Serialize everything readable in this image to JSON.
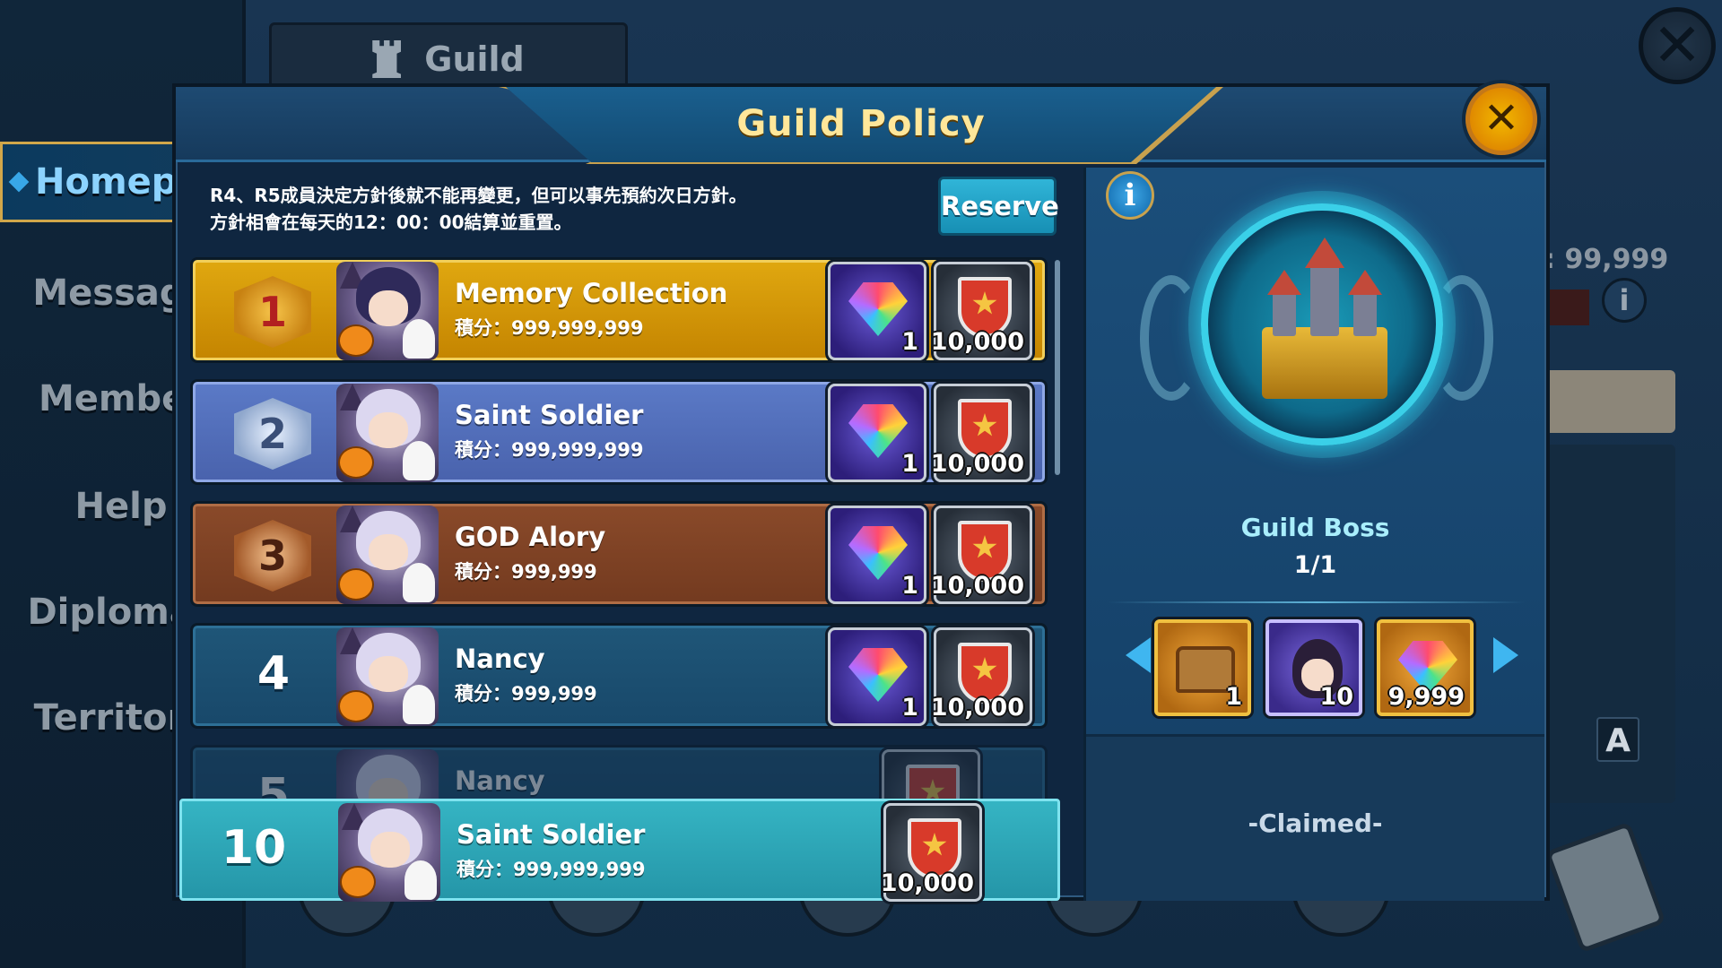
{
  "background": {
    "tab_title": "Guild",
    "sidebar": [
      {
        "label": "Homepag",
        "active": true
      },
      {
        "label": "Message",
        "active": false
      },
      {
        "label": "Member",
        "active": false
      },
      {
        "label": "Help",
        "active": false
      },
      {
        "label": "Diplomac",
        "active": false
      },
      {
        "label": "Territory",
        "active": false
      }
    ],
    "right_value": ": 99,999",
    "translate_icon_letter": "A",
    "close_glyph": "✕",
    "info_glyph": "i"
  },
  "modal": {
    "title": "Guild Policy",
    "close_glyph": "✕",
    "notice_line1": "R4、R5成員決定方針後就不能再變更，但可以事先預約次日方針。",
    "notice_line2": "方針相會在每天的12：00：00結算並重置。",
    "reserve_label": "Reserve"
  },
  "rankings": [
    {
      "rank": "1",
      "style": "gold",
      "name": "Memory Collection",
      "score": "積分：999,999,999",
      "gem_qty": "1",
      "shield_qty": "10,000",
      "avatar": "dark"
    },
    {
      "rank": "2",
      "style": "silver",
      "name": "Saint Soldier",
      "score": "積分：999,999,999",
      "gem_qty": "1",
      "shield_qty": "10,000",
      "avatar": "pale"
    },
    {
      "rank": "3",
      "style": "bronze",
      "name": "GOD  Alory",
      "score": "積分：999,999",
      "gem_qty": "1",
      "shield_qty": "10,000",
      "avatar": "pale"
    },
    {
      "rank": "4",
      "style": "plain",
      "name": "Nancy",
      "score": "積分：999,999",
      "gem_qty": "1",
      "shield_qty": "10,000",
      "avatar": "pale"
    },
    {
      "rank": "5",
      "style": "plain",
      "name": "Nancy",
      "score": "",
      "gem_qty": "",
      "shield_qty": "",
      "avatar": "pale"
    }
  ],
  "my_entry": {
    "rank": "10",
    "name": "Saint Soldier",
    "score": "積分：999,999,999",
    "shield_qty": "10,000"
  },
  "reward_panel": {
    "info_glyph": "i",
    "boss_label": "Guild Boss",
    "boss_progress": "1/1",
    "rewards": [
      {
        "icon": "treasure-chest-icon",
        "qty": "1"
      },
      {
        "icon": "hero-portrait-icon",
        "qty": "10"
      },
      {
        "icon": "rainbow-gem-icon",
        "qty": "9,999"
      }
    ],
    "status": "-Claimed-"
  },
  "colors": {
    "title_gold": "#ffe79a",
    "reserve_blue": "#30b5d8",
    "row_gold": "#e0a810",
    "row_silver": "#5b7ac7",
    "row_bronze": "#8a4a2a",
    "row_plain": "#1f5678",
    "my_row_teal": "#35b4c3",
    "boss_label": "#a9eefc"
  }
}
